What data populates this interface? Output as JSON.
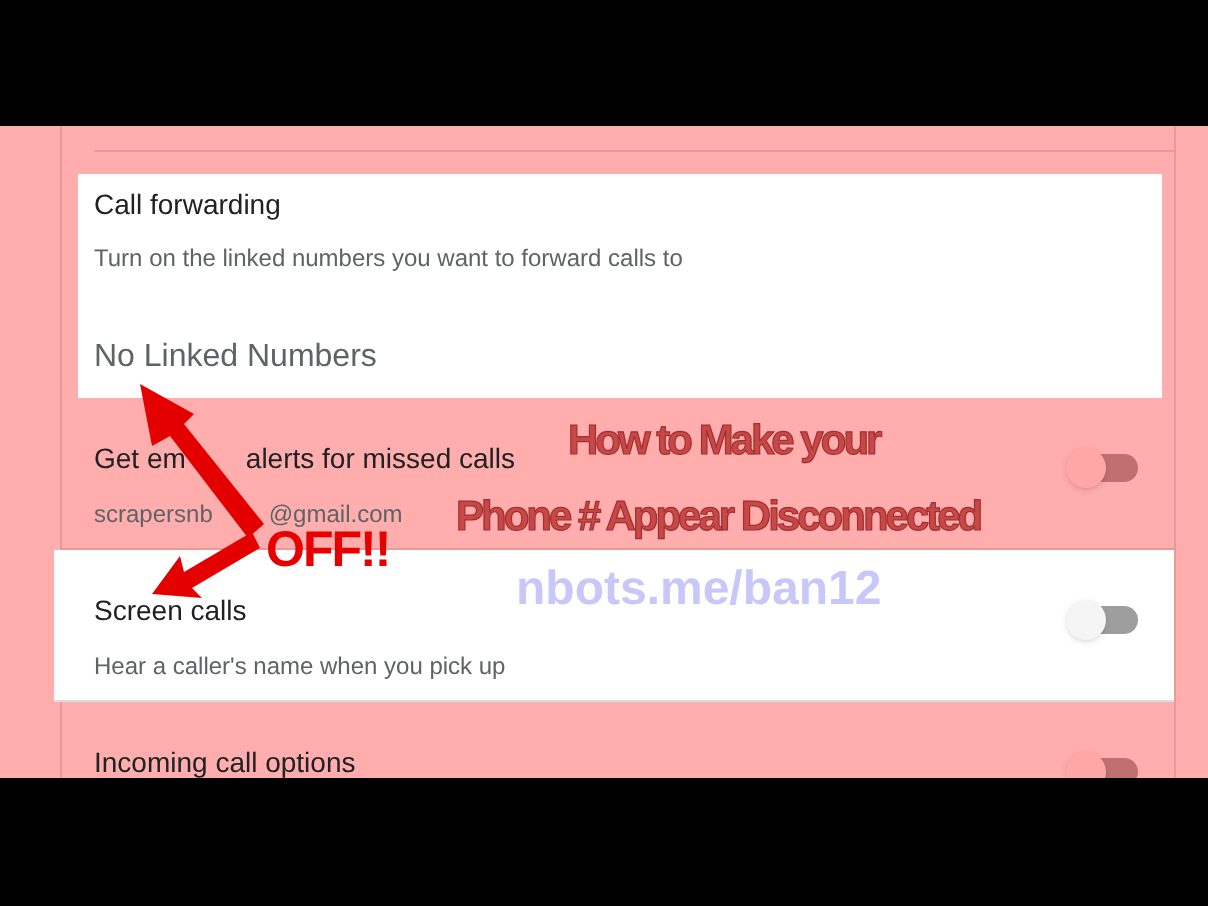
{
  "call_forwarding": {
    "title": "Call forwarding",
    "description": "Turn on the linked numbers you want to forward calls to",
    "empty_text": "No Linked Numbers"
  },
  "settings": [
    {
      "title_parts": [
        "Get em",
        "alerts for missed calls"
      ],
      "subtitle_parts": [
        "scrapersnb",
        "@gmail.com"
      ],
      "highlighted": false,
      "on": false
    },
    {
      "title_parts": [
        "Screen calls"
      ],
      "subtitle_parts": [
        "Hear a caller's name when you pick up"
      ],
      "highlighted": true,
      "on": false
    },
    {
      "title_parts": [
        "Incoming call options"
      ],
      "highlighted": false,
      "on": false
    }
  ],
  "annotations": [
    {
      "kind": "headline",
      "text": "How to Make your"
    },
    {
      "kind": "headline",
      "text": "Phone # Appear Disconnected"
    },
    {
      "kind": "link",
      "text": "nbots.me/ban12"
    },
    {
      "kind": "callout",
      "text": "OFF!!"
    }
  ]
}
